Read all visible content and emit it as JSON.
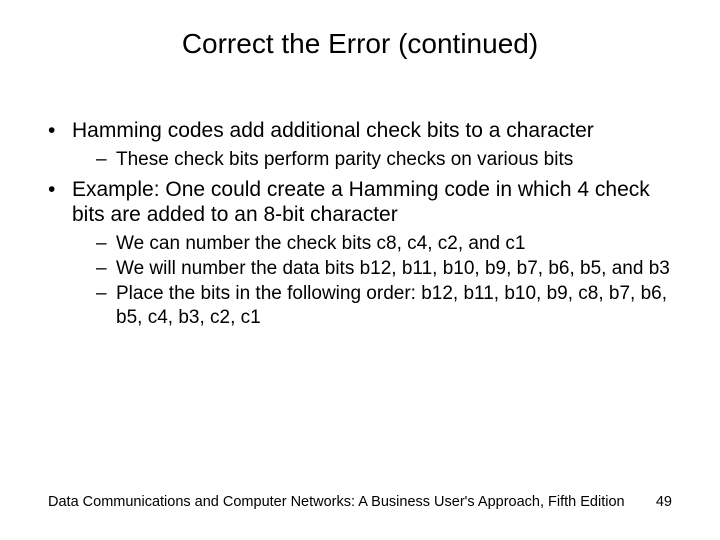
{
  "title": "Correct the Error (continued)",
  "bullets": [
    {
      "text": "Hamming codes add additional check bits to a character",
      "sub": [
        "These check bits perform parity checks on various bits"
      ]
    },
    {
      "text": "Example: One could create a Hamming code in which 4 check bits are added to an 8-bit character",
      "sub": [
        "We can number the check bits c8, c4, c2, and c1",
        "We will number the data bits b12, b11, b10, b9, b7, b6, b5, and b3",
        "Place the bits in the following order: b12, b11, b10, b9, c8, b7, b6, b5, c4, b3, c2, c1"
      ]
    }
  ],
  "footer": {
    "source": "Data Communications and Computer Networks: A Business User's Approach, Fifth Edition",
    "page": "49"
  }
}
